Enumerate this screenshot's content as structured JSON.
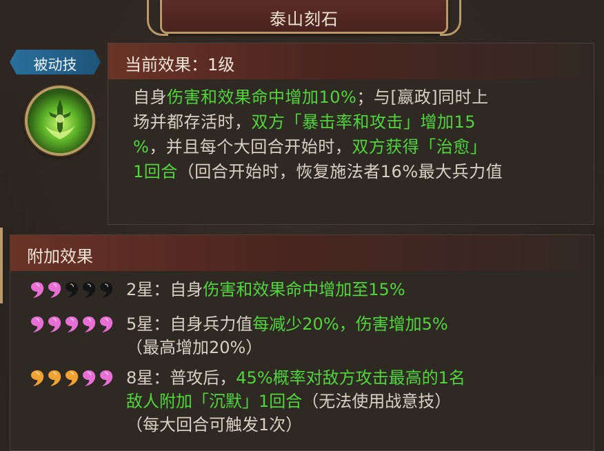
{
  "title": "泰山刻石",
  "skill_type_tag": "被动技",
  "current": {
    "header": "当前效果：1级",
    "line1": [
      {
        "t": "自身",
        "c": "n"
      },
      {
        "t": "伤害和效果命中增加10%",
        "c": "g"
      },
      {
        "t": "；与[嬴政]同时上",
        "c": "n"
      }
    ],
    "line2": [
      {
        "t": "场并都存活时，",
        "c": "n"
      },
      {
        "t": "双方「暴击率和攻击」增加15",
        "c": "g"
      }
    ],
    "line3": [
      {
        "t": "%",
        "c": "g"
      },
      {
        "t": "，并且每个大回合开始时，",
        "c": "n"
      },
      {
        "t": "双方获得「治愈」",
        "c": "g"
      }
    ],
    "line4": [
      {
        "t": "1回合",
        "c": "g"
      },
      {
        "t": "（回合开始时，恢复施法者16%最大兵力值",
        "c": "n"
      }
    ]
  },
  "extra": {
    "header": "附加效果",
    "rows": [
      {
        "stars_pink": 2,
        "stars_black": 3,
        "stars_orange": 0,
        "lines": [
          [
            {
              "t": "2星：自身",
              "c": "n"
            },
            {
              "t": "伤害和效果命中增加至15%",
              "c": "g"
            }
          ]
        ]
      },
      {
        "stars_pink": 5,
        "stars_black": 0,
        "stars_orange": 0,
        "lines": [
          [
            {
              "t": "5星：自身兵力值",
              "c": "n"
            },
            {
              "t": "每减少20%，伤害增加5%",
              "c": "g"
            }
          ],
          [
            {
              "t": "（最高增加20%）",
              "c": "n"
            }
          ]
        ]
      },
      {
        "stars_pink": 2,
        "stars_black": 0,
        "stars_orange": 3,
        "lines": [
          [
            {
              "t": "8星：普攻后，",
              "c": "n"
            },
            {
              "t": "45%概率对敌方攻击最高的1名",
              "c": "g"
            }
          ],
          [
            {
              "t": "敌人附加「沉默」1回合",
              "c": "g"
            },
            {
              "t": "（无法使用战意技）",
              "c": "n"
            }
          ],
          [
            {
              "t": "（每大回合可触发1次）",
              "c": "n"
            }
          ]
        ]
      }
    ]
  },
  "colors": {
    "green": "#52d43c",
    "pink": "#e86fd4",
    "orange": "#f0a233",
    "black": "#141414",
    "gold": "#b9996a"
  }
}
